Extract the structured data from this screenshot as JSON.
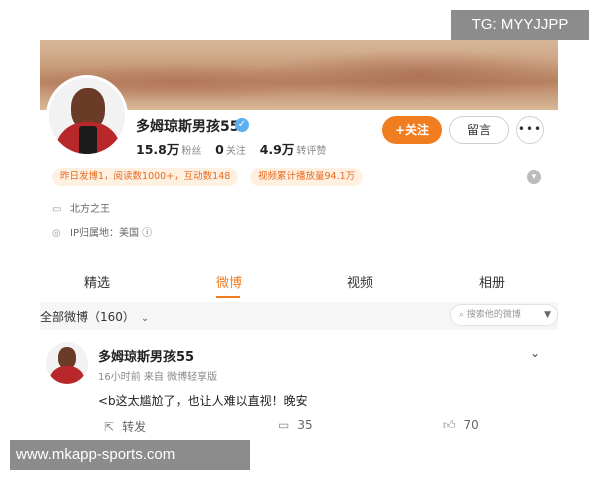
{
  "watermark_top": "TG: MYYJJPP",
  "watermark_bottom": "www.mkapp-sports.com",
  "profile": {
    "name": "多姆琼斯男孩55",
    "verified_icon": "check-circle-icon",
    "stats": [
      {
        "value": "15.8万",
        "label": "粉丝"
      },
      {
        "value": "0",
        "label": "关注"
      },
      {
        "value": "4.9万",
        "label": "转评赞"
      }
    ],
    "follow_label": "+关注",
    "message_label": "留言",
    "more_label": "•••",
    "badges": [
      "昨日发博1，阅读数1000+，互动数148",
      "视频累计播放量94.1万"
    ],
    "bio": "北方之王",
    "ip": "IP归属地：美国 ⓘ"
  },
  "tabs": [
    "精选",
    "微博",
    "视频",
    "相册"
  ],
  "active_tab": "微博",
  "filter": {
    "label": "全部微博（160）",
    "search_placeholder": "搜索他的微博"
  },
  "post": {
    "author": "多姆琼斯男孩55",
    "meta": "16小时前  来自 微博轻享版",
    "text": "<b这太尴尬了，也让人难以直视！晚安",
    "repost_label": "转发",
    "comments": "35",
    "likes": "70"
  },
  "colors": {
    "accent": "#f07e21",
    "badge_bg": "#fff1e2",
    "verify": "#5ab0f0"
  }
}
